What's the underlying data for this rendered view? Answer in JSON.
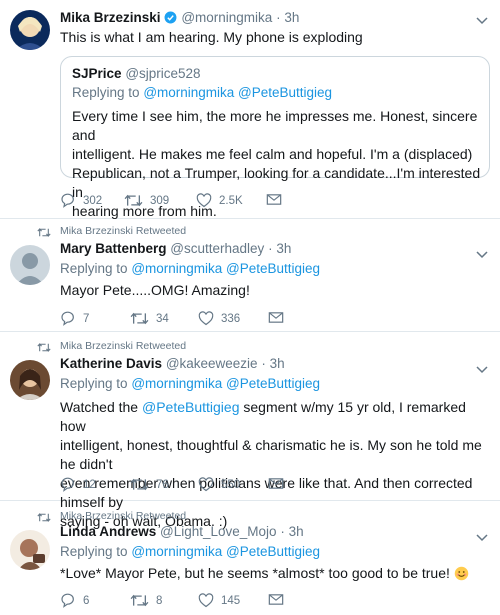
{
  "tweets": [
    {
      "name": "Mika Brzezinski",
      "handle": "@morningmika",
      "time": "3h",
      "text": "This is what I am hearing. My phone is exploding",
      "quote": {
        "name": "SJPrice",
        "handle": "@sjprice528",
        "replying_prefix": "Replying to",
        "replying_mentions": "@morningmika @PeteButtigieg",
        "lines": [
          "Every time I see him, the more he impresses me. Honest, sincere and",
          "intelligent. He makes me feel calm and hopeful. I'm a (displaced)",
          "Republican, not a Trumper, looking for a candidate...I'm interested in",
          "hearing more from him."
        ]
      },
      "counts": {
        "replies": "302",
        "retweets": "309",
        "likes": "2.5K"
      }
    },
    {
      "retweeted_by": "Mika Brzezinski Retweeted",
      "name": "Mary Battenberg",
      "handle": "@scutterhadley",
      "time": "3h",
      "replying_prefix": "Replying to",
      "replying_mentions": "@morningmika @PeteButtigieg",
      "text": "Mayor Pete.....OMG! Amazing!",
      "counts": {
        "replies": "7",
        "retweets": "34",
        "likes": "336"
      }
    },
    {
      "retweeted_by": "Mika Brzezinski Retweeted",
      "name": "Katherine Davis",
      "handle": "@kakeeweezie",
      "time": "3h",
      "replying_prefix": "Replying to",
      "replying_mentions": "@morningmika @PeteButtigieg",
      "text_first_prefix": "Watched the ",
      "text_first_mention": "@PeteButtigieg",
      "text_first_suffix": " segment w/my 15 yr old, I remarked how",
      "text_lines": [
        "intelligent, honest, thoughtful & charismatic he is. My son he told me he didn't",
        "even remember when politicians were like that. And then corrected himself by",
        "saying - oh wait, Obama. :)"
      ],
      "counts": {
        "replies": "12",
        "retweets": "76",
        "likes": "550"
      }
    },
    {
      "retweeted_by": "Mika Brzezinski Retweeted",
      "name": "Linda Andrews",
      "handle": "@Light_Love_Mojo",
      "time": "3h",
      "replying_prefix": "Replying to",
      "replying_mentions": "@morningmika @PeteButtigieg",
      "text": "*Love* Mayor Pete, but he seems *almost* too good to be true! ",
      "emoji": "smiling-face-emoji",
      "counts": {
        "replies": "6",
        "retweets": "8",
        "likes": "145"
      }
    }
  ],
  "separator": "·",
  "colors": {
    "link": "#1b95e0",
    "muted": "#657786",
    "verified": "#1da1f2",
    "border": "#e1e8ed"
  },
  "icons": [
    "reply-icon",
    "retweet-icon",
    "like-icon",
    "mail-icon",
    "chevron-down-icon",
    "verified-badge-icon"
  ]
}
